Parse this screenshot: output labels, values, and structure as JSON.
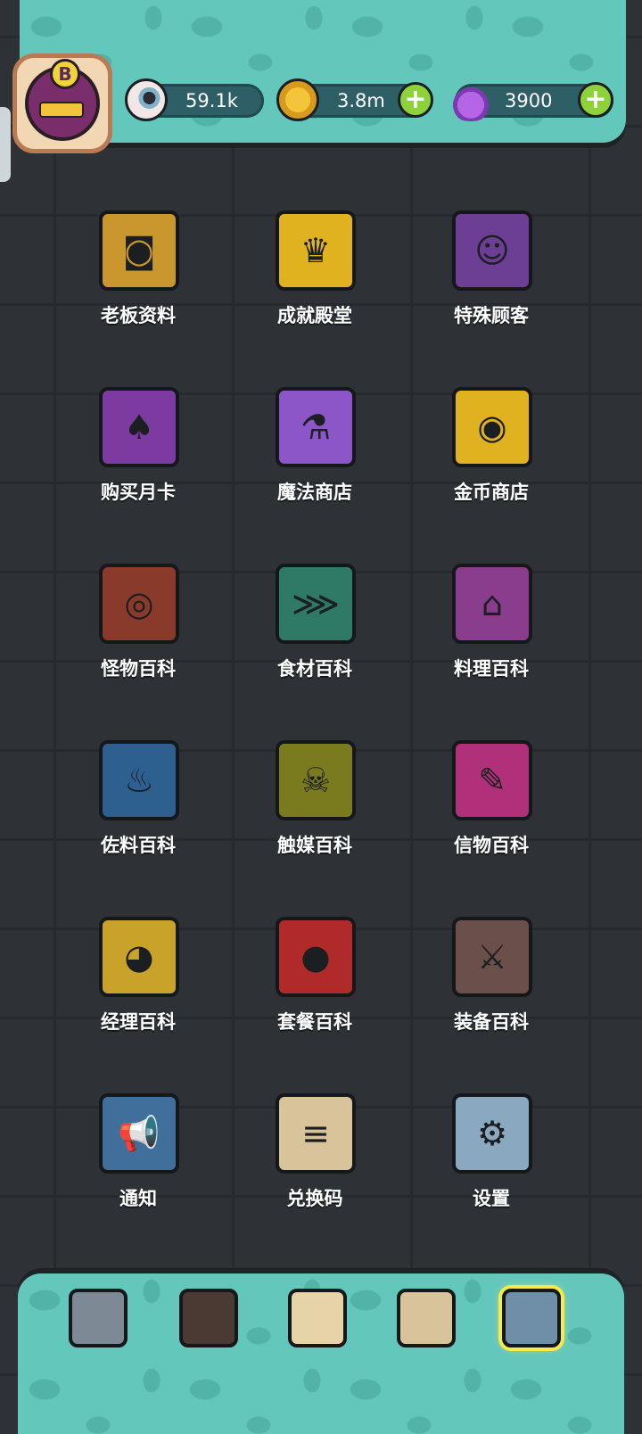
{
  "resources": {
    "eye": {
      "icon": "eyeball-icon",
      "value": "59.1k"
    },
    "coins": {
      "icon": "coin-icon",
      "value": "3.8m"
    },
    "potion": {
      "icon": "potion-icon",
      "value": "3900"
    }
  },
  "avatar": {
    "badge": "B"
  },
  "menu": [
    {
      "label": "老板资料",
      "icon": "id-card-icon",
      "color": "#c9972d"
    },
    {
      "label": "成就殿堂",
      "icon": "trophy-icon",
      "color": "#e0b21f"
    },
    {
      "label": "特殊顾客",
      "icon": "portrait-book-icon",
      "color": "#6d3f94"
    },
    {
      "label": "购买月卡",
      "icon": "monthly-card-icon",
      "color": "#7d3aa0"
    },
    {
      "label": "魔法商店",
      "icon": "potion-bottles-icon",
      "color": "#8c55c8"
    },
    {
      "label": "金币商店",
      "icon": "coin-stack-icon",
      "color": "#e0b21f"
    },
    {
      "label": "怪物百科",
      "icon": "monster-book-icon",
      "color": "#8a3a2a"
    },
    {
      "label": "食材百科",
      "icon": "fish-bone-book-icon",
      "color": "#2f7a66"
    },
    {
      "label": "料理百科",
      "icon": "cloche-book-icon",
      "color": "#8a3d8c"
    },
    {
      "label": "佐料百科",
      "icon": "sauce-book-icon",
      "color": "#2d5f8f"
    },
    {
      "label": "触媒百科",
      "icon": "skull-book-icon",
      "color": "#7a7a1f"
    },
    {
      "label": "信物百科",
      "icon": "token-book-icon",
      "color": "#b0307a"
    },
    {
      "label": "经理百科",
      "icon": "manager-book-icon",
      "color": "#c9a22a"
    },
    {
      "label": "套餐百科",
      "icon": "meal-book-icon",
      "color": "#b02a2a"
    },
    {
      "label": "装备百科",
      "icon": "sword-book-icon",
      "color": "#6a4f4a"
    },
    {
      "label": "通知",
      "icon": "horn-icon",
      "color": "#3f6f9a"
    },
    {
      "label": "兑换码",
      "icon": "scroll-icon",
      "color": "#d9c39a"
    },
    {
      "label": "设置",
      "icon": "gear-icon",
      "color": "#8aa8c0"
    }
  ],
  "bottom_nav": [
    {
      "name": "restaurant-icon",
      "color": "#7d8a96"
    },
    {
      "name": "monster-icon",
      "color": "#4a3a33"
    },
    {
      "name": "book-icon",
      "color": "#e6d4a8"
    },
    {
      "name": "money-bag-icon",
      "color": "#d8c49a"
    },
    {
      "name": "menu-grid-icon",
      "color": "#f4e040",
      "active": true
    }
  ]
}
